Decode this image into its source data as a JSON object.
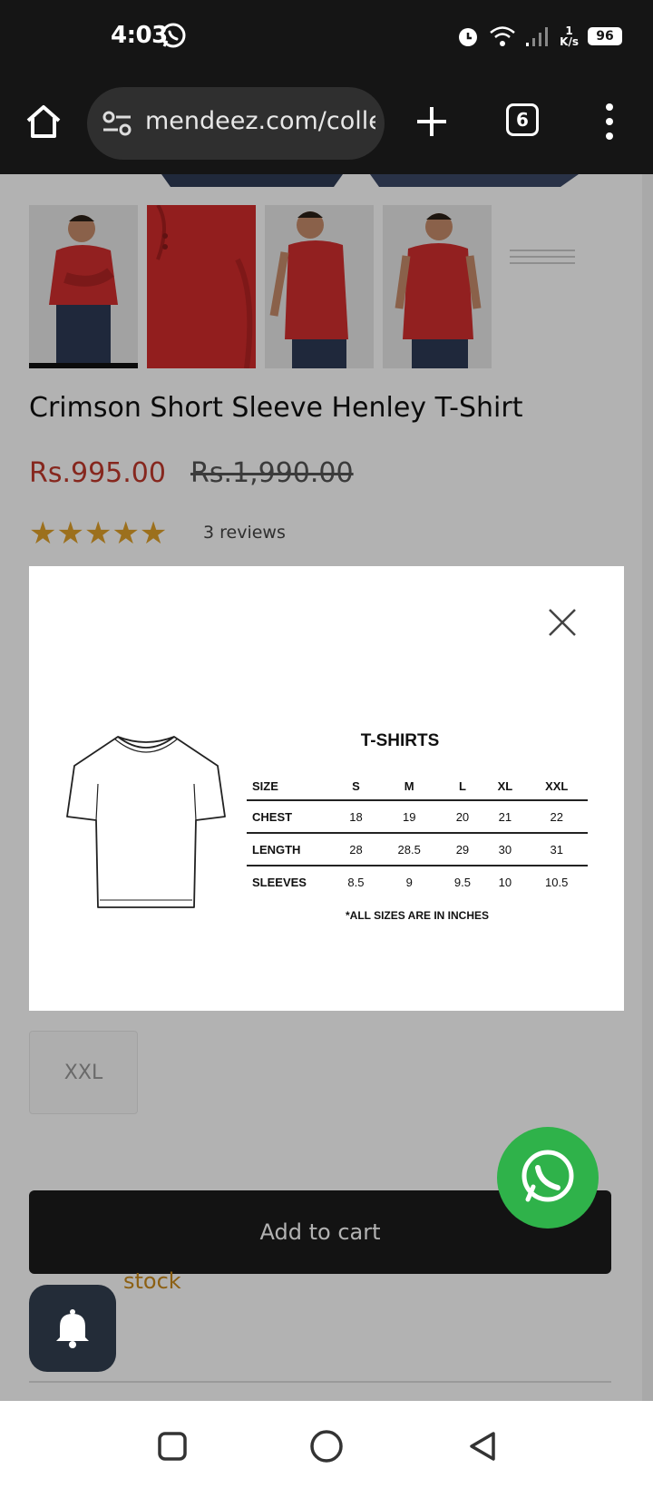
{
  "status_bar": {
    "time": "4:03",
    "battery": "96",
    "net_speed_value": "1",
    "net_speed_unit": "K/s"
  },
  "browser": {
    "url": "mendeez.com/collec",
    "tab_count": "6"
  },
  "product": {
    "title": "Crimson Short Sleeve Henley T-Shirt",
    "price": "Rs.995.00",
    "compare_price": "Rs.1,990.00",
    "rating_stars": 5,
    "rating_text": "★★★★★",
    "reviews": "3 reviews",
    "sizes_visible": [
      "XXL"
    ],
    "add_to_cart": "Add to cart",
    "stock_text": "stock"
  },
  "size_chart": {
    "title": "T-SHIRTS",
    "columns": [
      "SIZE",
      "S",
      "M",
      "L",
      "XL",
      "XXL"
    ],
    "rows": [
      [
        "CHEST",
        "18",
        "19",
        "20",
        "21",
        "22"
      ],
      [
        "LENGTH",
        "28",
        "28.5",
        "29",
        "30",
        "31"
      ],
      [
        "SLEEVES",
        "8.5",
        "9",
        "9.5",
        "10",
        "10.5"
      ]
    ],
    "note": "*ALL SIZES ARE IN INCHES"
  },
  "colors": {
    "price": "#c0392b",
    "star": "#e0a12a",
    "whatsapp": "#2fb24a",
    "bell_fab": "#232c38",
    "status_bar": "#151515"
  },
  "icons": [
    "home-icon",
    "tune-icon",
    "plus-icon",
    "tabs-icon",
    "more-vert-icon",
    "close-icon",
    "whatsapp-icon",
    "bell-icon",
    "recents-icon",
    "home-circle-icon",
    "back-icon"
  ]
}
